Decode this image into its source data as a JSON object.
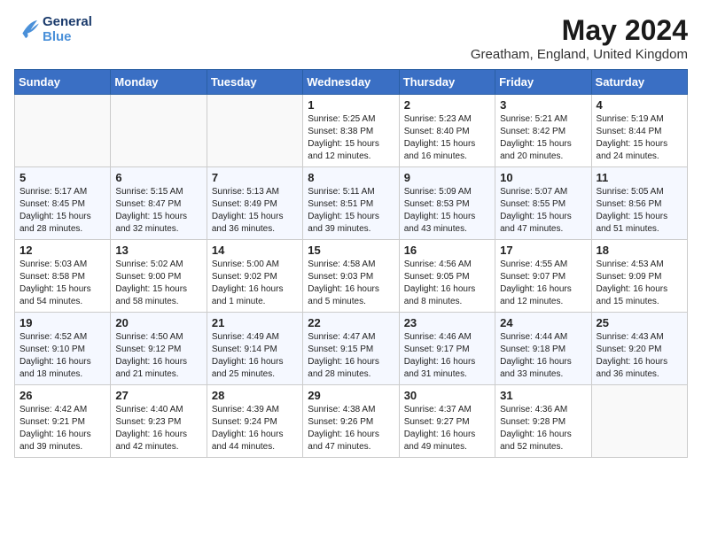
{
  "header": {
    "logo_line1": "General",
    "logo_line2": "Blue",
    "month_year": "May 2024",
    "location": "Greatham, England, United Kingdom"
  },
  "days_of_week": [
    "Sunday",
    "Monday",
    "Tuesday",
    "Wednesday",
    "Thursday",
    "Friday",
    "Saturday"
  ],
  "weeks": [
    [
      {
        "day": "",
        "info": ""
      },
      {
        "day": "",
        "info": ""
      },
      {
        "day": "",
        "info": ""
      },
      {
        "day": "1",
        "info": "Sunrise: 5:25 AM\nSunset: 8:38 PM\nDaylight: 15 hours\nand 12 minutes."
      },
      {
        "day": "2",
        "info": "Sunrise: 5:23 AM\nSunset: 8:40 PM\nDaylight: 15 hours\nand 16 minutes."
      },
      {
        "day": "3",
        "info": "Sunrise: 5:21 AM\nSunset: 8:42 PM\nDaylight: 15 hours\nand 20 minutes."
      },
      {
        "day": "4",
        "info": "Sunrise: 5:19 AM\nSunset: 8:44 PM\nDaylight: 15 hours\nand 24 minutes."
      }
    ],
    [
      {
        "day": "5",
        "info": "Sunrise: 5:17 AM\nSunset: 8:45 PM\nDaylight: 15 hours\nand 28 minutes."
      },
      {
        "day": "6",
        "info": "Sunrise: 5:15 AM\nSunset: 8:47 PM\nDaylight: 15 hours\nand 32 minutes."
      },
      {
        "day": "7",
        "info": "Sunrise: 5:13 AM\nSunset: 8:49 PM\nDaylight: 15 hours\nand 36 minutes."
      },
      {
        "day": "8",
        "info": "Sunrise: 5:11 AM\nSunset: 8:51 PM\nDaylight: 15 hours\nand 39 minutes."
      },
      {
        "day": "9",
        "info": "Sunrise: 5:09 AM\nSunset: 8:53 PM\nDaylight: 15 hours\nand 43 minutes."
      },
      {
        "day": "10",
        "info": "Sunrise: 5:07 AM\nSunset: 8:55 PM\nDaylight: 15 hours\nand 47 minutes."
      },
      {
        "day": "11",
        "info": "Sunrise: 5:05 AM\nSunset: 8:56 PM\nDaylight: 15 hours\nand 51 minutes."
      }
    ],
    [
      {
        "day": "12",
        "info": "Sunrise: 5:03 AM\nSunset: 8:58 PM\nDaylight: 15 hours\nand 54 minutes."
      },
      {
        "day": "13",
        "info": "Sunrise: 5:02 AM\nSunset: 9:00 PM\nDaylight: 15 hours\nand 58 minutes."
      },
      {
        "day": "14",
        "info": "Sunrise: 5:00 AM\nSunset: 9:02 PM\nDaylight: 16 hours\nand 1 minute."
      },
      {
        "day": "15",
        "info": "Sunrise: 4:58 AM\nSunset: 9:03 PM\nDaylight: 16 hours\nand 5 minutes."
      },
      {
        "day": "16",
        "info": "Sunrise: 4:56 AM\nSunset: 9:05 PM\nDaylight: 16 hours\nand 8 minutes."
      },
      {
        "day": "17",
        "info": "Sunrise: 4:55 AM\nSunset: 9:07 PM\nDaylight: 16 hours\nand 12 minutes."
      },
      {
        "day": "18",
        "info": "Sunrise: 4:53 AM\nSunset: 9:09 PM\nDaylight: 16 hours\nand 15 minutes."
      }
    ],
    [
      {
        "day": "19",
        "info": "Sunrise: 4:52 AM\nSunset: 9:10 PM\nDaylight: 16 hours\nand 18 minutes."
      },
      {
        "day": "20",
        "info": "Sunrise: 4:50 AM\nSunset: 9:12 PM\nDaylight: 16 hours\nand 21 minutes."
      },
      {
        "day": "21",
        "info": "Sunrise: 4:49 AM\nSunset: 9:14 PM\nDaylight: 16 hours\nand 25 minutes."
      },
      {
        "day": "22",
        "info": "Sunrise: 4:47 AM\nSunset: 9:15 PM\nDaylight: 16 hours\nand 28 minutes."
      },
      {
        "day": "23",
        "info": "Sunrise: 4:46 AM\nSunset: 9:17 PM\nDaylight: 16 hours\nand 31 minutes."
      },
      {
        "day": "24",
        "info": "Sunrise: 4:44 AM\nSunset: 9:18 PM\nDaylight: 16 hours\nand 33 minutes."
      },
      {
        "day": "25",
        "info": "Sunrise: 4:43 AM\nSunset: 9:20 PM\nDaylight: 16 hours\nand 36 minutes."
      }
    ],
    [
      {
        "day": "26",
        "info": "Sunrise: 4:42 AM\nSunset: 9:21 PM\nDaylight: 16 hours\nand 39 minutes."
      },
      {
        "day": "27",
        "info": "Sunrise: 4:40 AM\nSunset: 9:23 PM\nDaylight: 16 hours\nand 42 minutes."
      },
      {
        "day": "28",
        "info": "Sunrise: 4:39 AM\nSunset: 9:24 PM\nDaylight: 16 hours\nand 44 minutes."
      },
      {
        "day": "29",
        "info": "Sunrise: 4:38 AM\nSunset: 9:26 PM\nDaylight: 16 hours\nand 47 minutes."
      },
      {
        "day": "30",
        "info": "Sunrise: 4:37 AM\nSunset: 9:27 PM\nDaylight: 16 hours\nand 49 minutes."
      },
      {
        "day": "31",
        "info": "Sunrise: 4:36 AM\nSunset: 9:28 PM\nDaylight: 16 hours\nand 52 minutes."
      },
      {
        "day": "",
        "info": ""
      }
    ]
  ]
}
